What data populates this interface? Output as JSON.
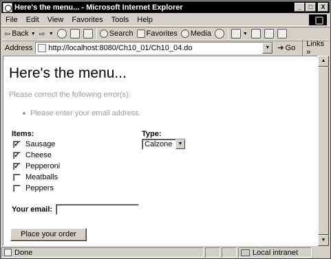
{
  "window": {
    "title": "Here's the menu... - Microsoft Internet Explorer",
    "controls": {
      "minimize": "_",
      "maximize": "□",
      "close": "X"
    }
  },
  "menubar": [
    "File",
    "Edit",
    "View",
    "Favorites",
    "Tools",
    "Help"
  ],
  "toolbar": {
    "back": "Back",
    "search": "Search",
    "favorites": "Favorites",
    "media": "Media"
  },
  "address": {
    "label": "Address",
    "url": "http://localhost:8080/Ch10_01/Ch10_04.do",
    "go": "Go",
    "links": "Links"
  },
  "page": {
    "heading": "Here's the menu...",
    "error_intro": "Please correct the following error(s):",
    "errors": [
      "Please enter your email address."
    ],
    "items_label": "Items:",
    "type_label": "Type:",
    "items": [
      {
        "label": "Sausage",
        "checked": true
      },
      {
        "label": "Cheese",
        "checked": true
      },
      {
        "label": "Pepperoni",
        "checked": true
      },
      {
        "label": "Meatballs",
        "checked": false
      },
      {
        "label": "Peppers",
        "checked": false
      }
    ],
    "type_selected": "Calzone",
    "email_label": "Your email:",
    "email_value": "",
    "submit_label": "Place your order"
  },
  "status": {
    "text": "Done",
    "zone": "Local intranet"
  }
}
